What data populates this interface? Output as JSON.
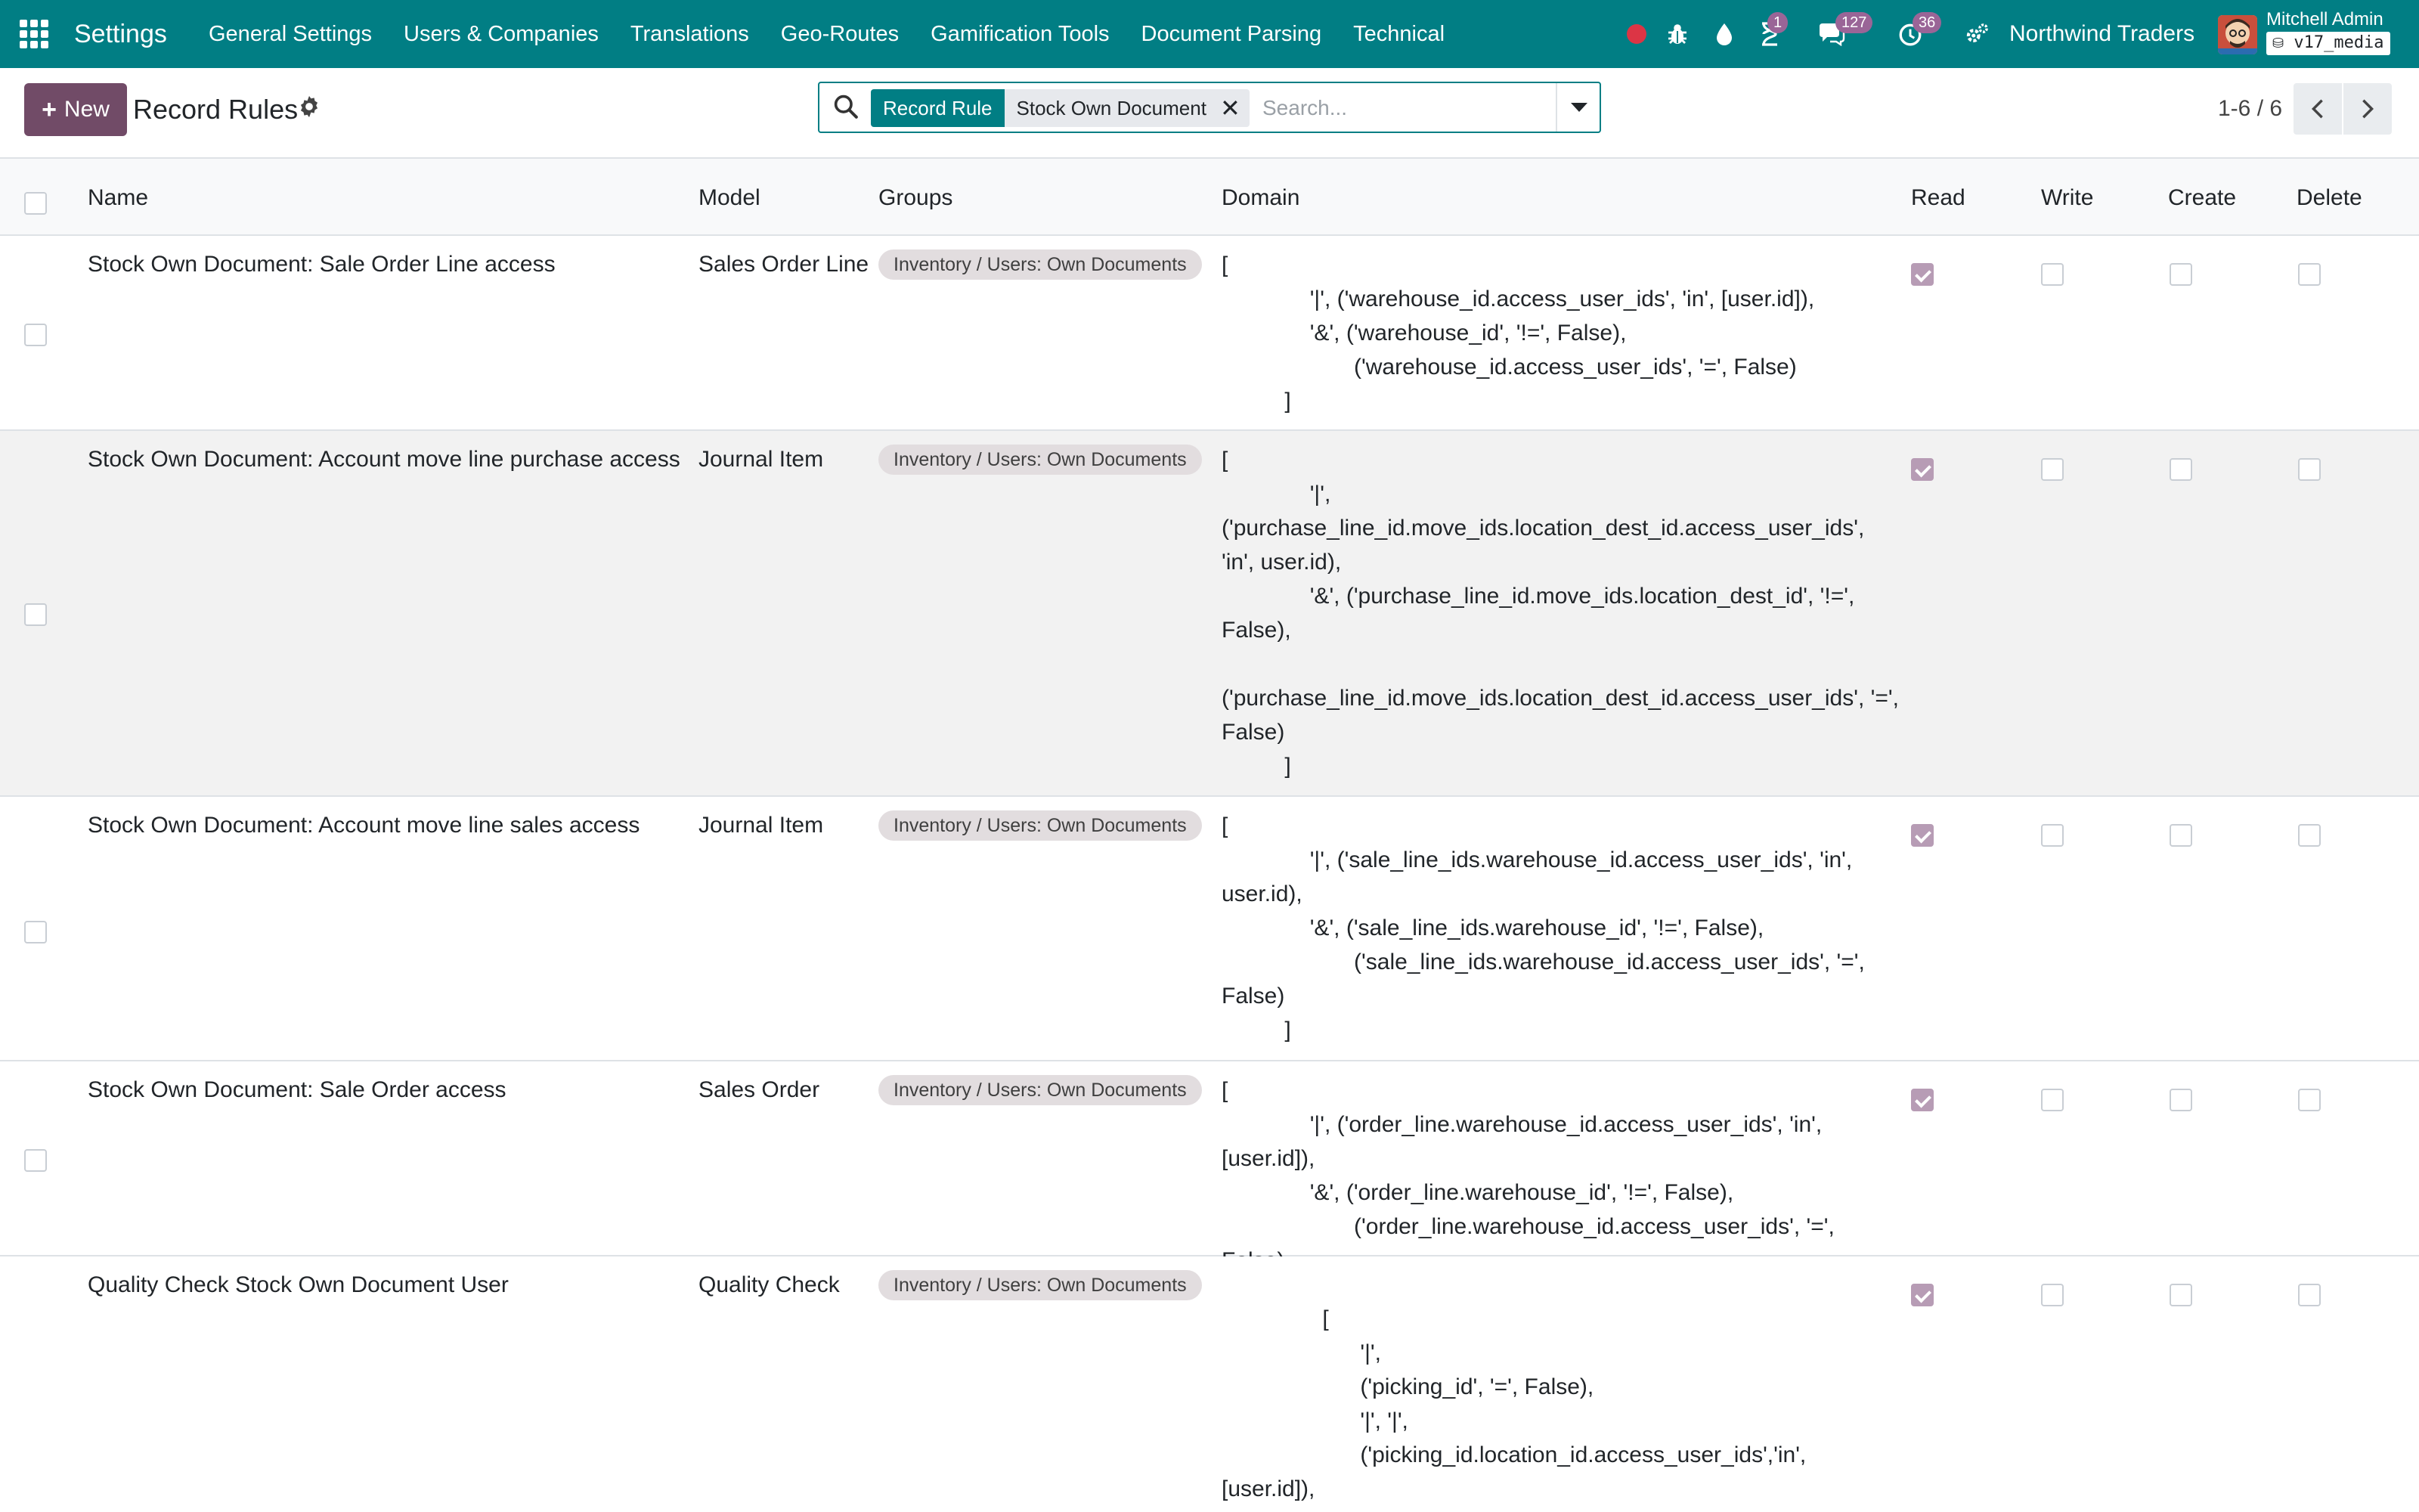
{
  "navbar": {
    "brand": "Settings",
    "menu": [
      "General Settings",
      "Users & Companies",
      "Translations",
      "Geo-Routes",
      "Gamification Tools",
      "Document Parsing",
      "Technical"
    ],
    "activity_badge": "1",
    "messages_badge": "127",
    "timer_badge": "36",
    "company": "Northwind Traders",
    "user": "Mitchell Admin",
    "database": "v17_media"
  },
  "control": {
    "new_label": "New",
    "title": "Record Rules",
    "facet_label": "Record Rule",
    "facet_value": "Stock Own Document",
    "search_placeholder": "Search...",
    "pager": "1-6 / 6"
  },
  "columns": {
    "name": "Name",
    "model": "Model",
    "groups": "Groups",
    "domain": "Domain",
    "read": "Read",
    "write": "Write",
    "create": "Create",
    "delete": "Delete"
  },
  "rows": [
    {
      "name": "Stock Own Document: Sale Order Line access",
      "model": "Sales Order Line",
      "group": "Inventory / Users: Own Documents",
      "domain": "[\n              '|', ('warehouse_id.access_user_ids', 'in', [user.id]),\n              '&', ('warehouse_id', '!=', False),\n                     ('warehouse_id.access_user_ids', '=', False)\n          ]",
      "read": true,
      "write": false,
      "create": false,
      "delete": false
    },
    {
      "name": "Stock Own Document: Account move line purchase access",
      "model": "Journal Item",
      "group": "Inventory / Users: Own Documents",
      "domain": "[\n              '|',\n('purchase_line_id.move_ids.location_dest_id.access_user_ids', 'in', user.id),\n              '&', ('purchase_line_id.move_ids.location_dest_id', '!=', False),\n\n('purchase_line_id.move_ids.location_dest_id.access_user_ids', '=', False)\n          ]",
      "read": true,
      "write": false,
      "create": false,
      "delete": false
    },
    {
      "name": "Stock Own Document: Account move line sales access",
      "model": "Journal Item",
      "group": "Inventory / Users: Own Documents",
      "domain": "[\n              '|', ('sale_line_ids.warehouse_id.access_user_ids', 'in', user.id),\n              '&', ('sale_line_ids.warehouse_id', '!=', False),\n                     ('sale_line_ids.warehouse_id.access_user_ids', '=', False)\n          ]",
      "read": true,
      "write": false,
      "create": false,
      "delete": false
    },
    {
      "name": "Stock Own Document: Sale Order access",
      "model": "Sales Order",
      "group": "Inventory / Users: Own Documents",
      "domain": "[\n              '|', ('order_line.warehouse_id.access_user_ids', 'in', [user.id]),\n              '&', ('order_line.warehouse_id', '!=', False),\n                     ('order_line.warehouse_id.access_user_ids', '=', False)\n          ]",
      "read": true,
      "write": false,
      "create": false,
      "delete": false
    },
    {
      "name": "Quality Check Stock Own Document User",
      "model": "Quality Check",
      "group": "Inventory / Users: Own Documents",
      "domain": "                [\n                      '|',\n                      ('picking_id', '=', False),\n                      '|', '|',\n                      ('picking_id.location_id.access_user_ids','in',\n[user.id]),",
      "read": true,
      "write": false,
      "create": false,
      "delete": false
    }
  ]
}
